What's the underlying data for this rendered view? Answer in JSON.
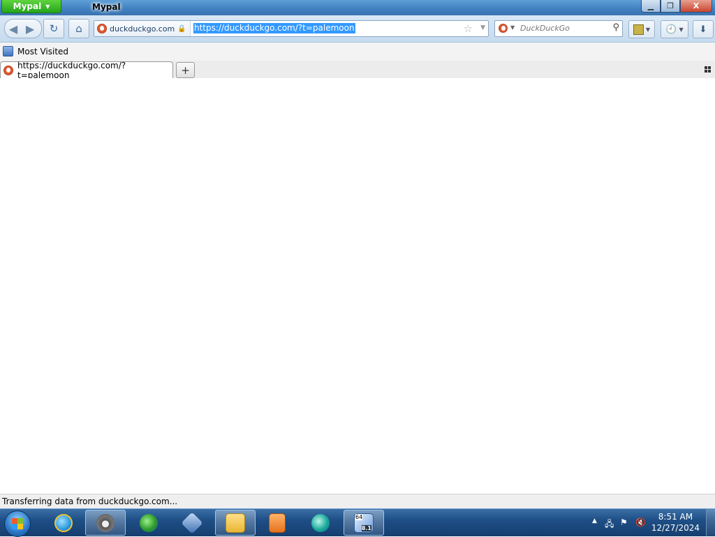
{
  "window": {
    "app_menu_label": "Mypal",
    "title": "Mypal",
    "controls": {
      "minimize": "▁",
      "maximize": "❐",
      "close": "X"
    }
  },
  "navbar": {
    "identity_domain": "duckduckgo.com",
    "url": "https://duckduckgo.com/?t=palemoon",
    "search_placeholder": "DuckDuckGo"
  },
  "bookmarks": {
    "items": [
      {
        "label": "Most Visited"
      }
    ]
  },
  "tabs": [
    {
      "title": "https://duckduckgo.com/?t=palemoon",
      "active": true
    }
  ],
  "new_tab_label": "+",
  "status": {
    "text": "Transferring data from duckduckgo.com..."
  },
  "taskbar": {
    "apps": [
      {
        "name": "internet-explorer-icon",
        "active": false
      },
      {
        "name": "mypal-raccoon-icon",
        "active": true
      },
      {
        "name": "internet-download-manager-icon",
        "active": false
      },
      {
        "name": "virtualbox-icon",
        "active": false
      },
      {
        "name": "file-explorer-icon",
        "active": false
      },
      {
        "name": "media-player-icon",
        "active": false
      },
      {
        "name": "app-icon-teal",
        "active": false
      },
      {
        "name": "system-64-8-1-icon",
        "active": false
      }
    ],
    "system_badge_top": "64",
    "system_badge_bottom": "8.1",
    "clock_time": "8:51 AM",
    "clock_date": "12/27/2024"
  },
  "colors": {
    "selection": "#3399ff",
    "titlebar": "#3f7fbf",
    "app_menu": "#25a51a",
    "taskbar": "#1e4f86"
  }
}
